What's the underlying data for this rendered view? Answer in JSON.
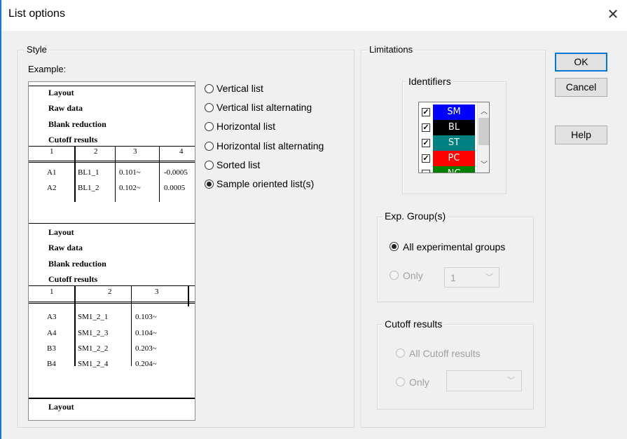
{
  "window": {
    "title": "List options",
    "close_glyph": "✕"
  },
  "style_group": {
    "label": "Style",
    "example_label": "Example:",
    "options": [
      {
        "label": "Vertical list",
        "selected": false
      },
      {
        "label": "Vertical list alternating",
        "selected": false
      },
      {
        "label": "Horizontal list",
        "selected": false
      },
      {
        "label": "Horizontal list alternating",
        "selected": false
      },
      {
        "label": "Sorted list",
        "selected": false
      },
      {
        "label": "Sample oriented list(s)",
        "selected": true
      }
    ]
  },
  "example_preview": {
    "block1": {
      "titles": [
        "Layout",
        "Raw data",
        "Blank reduction",
        "Cutoff results"
      ],
      "headers": [
        "1",
        "2",
        "3",
        "4"
      ],
      "rows": [
        [
          "A1",
          "BL1_1",
          "0.101~",
          "-0.0005"
        ],
        [
          "A2",
          "BL1_2",
          "0.102~",
          "0.0005"
        ]
      ]
    },
    "block2": {
      "titles": [
        "Layout",
        "Raw data",
        "Blank reduction",
        "Cutoff results"
      ],
      "headers": [
        "1",
        "2",
        "3"
      ],
      "rows": [
        [
          "A3",
          "SM1_2_1",
          "0.103~"
        ],
        [
          "A4",
          "SM1_2_3",
          "0.104~"
        ],
        [
          "B3",
          "SM1_2_2",
          "0.203~"
        ],
        [
          "B4",
          "SM1_2_4",
          "0.204~"
        ]
      ]
    },
    "footer_title": "Layout"
  },
  "limitations": {
    "label": "Limitations",
    "identifiers": {
      "label": "Identifiers",
      "items": [
        {
          "label": "SM",
          "color": "#0000ff",
          "checked": true
        },
        {
          "label": "BL",
          "color": "#000000",
          "checked": true
        },
        {
          "label": "ST",
          "color": "#008080",
          "checked": true
        },
        {
          "label": "PC",
          "color": "#ff0000",
          "checked": true
        },
        {
          "label": "NC",
          "color": "#008000",
          "checked": false
        }
      ]
    },
    "exp_groups": {
      "label": "Exp. Group(s)",
      "all_label": "All experimental groups",
      "only_label": "Only",
      "only_value": "1"
    },
    "cutoff": {
      "label": "Cutoff results",
      "all_label": "All Cutoff results",
      "only_label": "Only",
      "only_value": ""
    }
  },
  "buttons": {
    "ok": "OK",
    "cancel": "Cancel",
    "help": "Help"
  }
}
